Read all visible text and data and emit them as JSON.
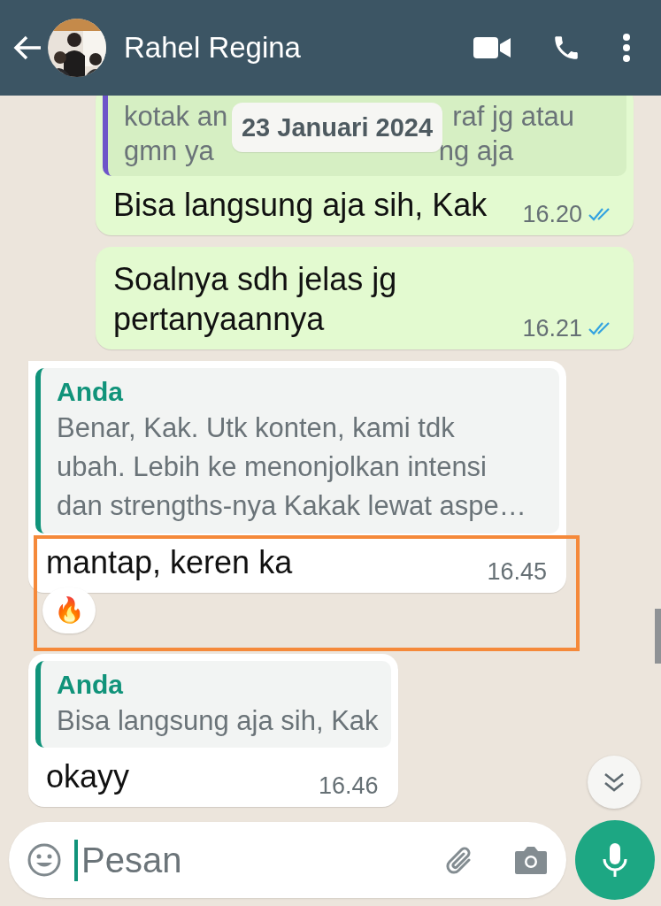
{
  "header": {
    "contact_name": "Rahel Regina"
  },
  "date_chip": "23 Januari 2024",
  "messages": [
    {
      "kind": "outgoing",
      "quote": {
        "lines": [
          [
            "kotak an",
            "raf jg atau"
          ],
          [
            "gmn ya",
            "ng aja"
          ]
        ]
      },
      "text": "Bisa langsung aja sih, Kak",
      "time": "16.20",
      "read": true,
      "tail": false,
      "highlighted": false
    },
    {
      "kind": "outgoing",
      "text": "Soalnya sdh jelas jg pertanyaannya",
      "time": "16.21",
      "read": true,
      "tail": false,
      "highlighted": false
    },
    {
      "kind": "incoming",
      "quote": {
        "author": "Anda",
        "lines": [
          "Benar, Kak. Utk konten, kami tdk",
          "ubah. Lebih ke menonjolkan intensi",
          "dan strengths-nya Kakak lewat aspe…"
        ]
      },
      "text": "mantap, keren ka",
      "time": "16.45",
      "reaction": "🔥",
      "tail": true,
      "highlighted": true
    },
    {
      "kind": "incoming",
      "quote": {
        "author": "Anda",
        "lines": [
          "Bisa langsung aja sih, Kak"
        ]
      },
      "text": "okayy",
      "time": "16.46",
      "tail": false,
      "highlighted": false
    }
  ],
  "composer": {
    "placeholder": "Pesan"
  }
}
